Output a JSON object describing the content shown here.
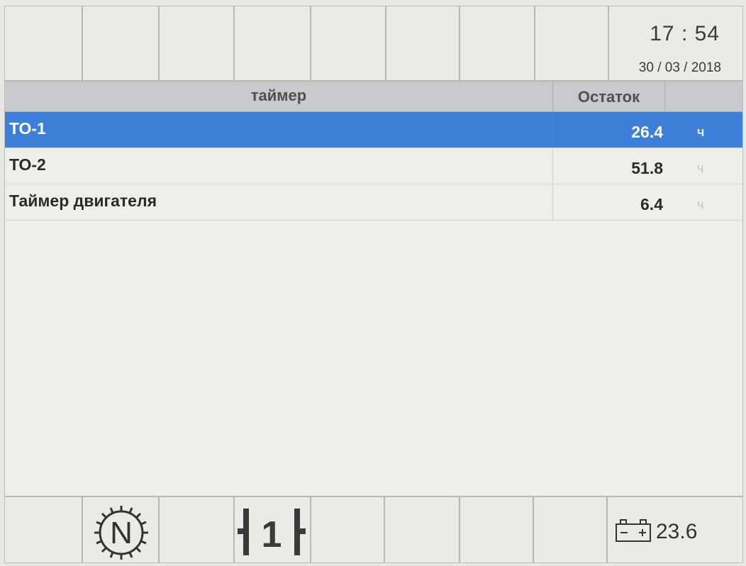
{
  "clock": {
    "time": "17 : 54",
    "date": "30 / 03 / 2018"
  },
  "table": {
    "header_timer": "таймер",
    "header_rest": "Остаток",
    "rows": [
      {
        "name": "ТО-1",
        "value": "26.4",
        "unit": "ч",
        "selected": true
      },
      {
        "name": "ТО-2",
        "value": "51.8",
        "unit": "ч",
        "selected": false
      },
      {
        "name": "Таймер двигателя",
        "value": "6.4",
        "unit": "ч",
        "selected": false
      }
    ]
  },
  "status": {
    "gear_indicator": "N",
    "gear_position": "1",
    "battery_voltage": "23.6"
  },
  "icons": {
    "neutral_gear": "neutral-gear-icon",
    "gearbox": "gearbox-position-icon",
    "battery": "battery-icon"
  },
  "colors": {
    "selection": "#3c7fd8",
    "header": "#c7c9cc"
  }
}
